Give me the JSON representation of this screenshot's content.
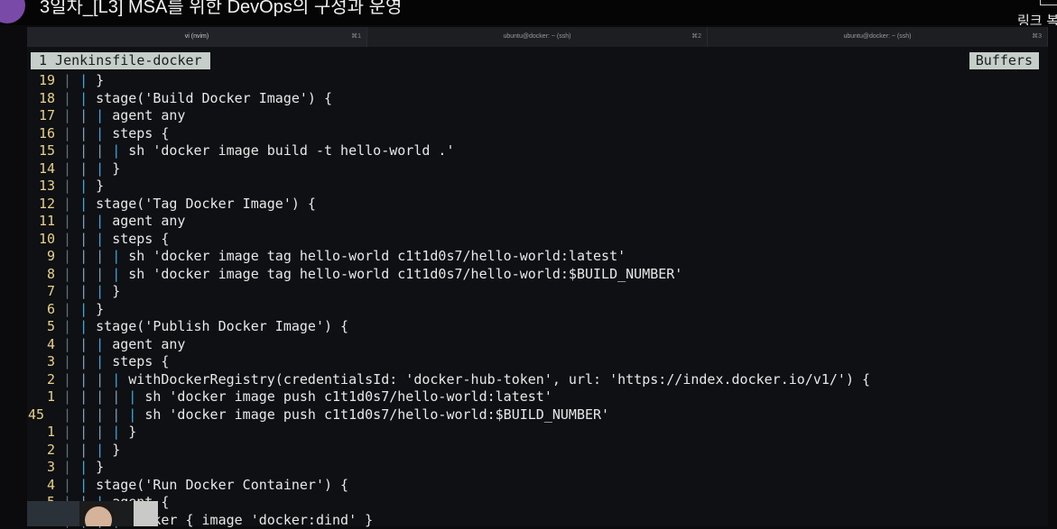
{
  "video": {
    "title": "3일차_[L3] MSA를 위한 DevOps의 구성과 운영",
    "corner_label": "링크 복"
  },
  "tabs": [
    {
      "label": "vi (nvim)",
      "key": "⌘1",
      "active": true
    },
    {
      "label": "ubuntu@docker: ~ (ssh)",
      "key": "⌘2",
      "active": false
    },
    {
      "label": "ubuntu@docker: ~ (ssh)",
      "key": "⌘3",
      "active": false
    }
  ],
  "bufferline": {
    "file": "1 Jenkinsfile-docker",
    "buffers_label": "Buffers"
  },
  "editor": {
    "current_line": "45",
    "lines": [
      {
        "n": "19",
        "indent": 2,
        "code": "}"
      },
      {
        "n": "18",
        "indent": 2,
        "code": "stage('Build Docker Image') {"
      },
      {
        "n": "17",
        "indent": 3,
        "code": "agent any"
      },
      {
        "n": "16",
        "indent": 3,
        "code": "steps {"
      },
      {
        "n": "15",
        "indent": 4,
        "code": "sh 'docker image build -t hello-world .'"
      },
      {
        "n": "14",
        "indent": 3,
        "code": "}"
      },
      {
        "n": "13",
        "indent": 2,
        "code": "}"
      },
      {
        "n": "12",
        "indent": 2,
        "code": "stage('Tag Docker Image') {"
      },
      {
        "n": "11",
        "indent": 3,
        "code": "agent any"
      },
      {
        "n": "10",
        "indent": 3,
        "code": "steps {"
      },
      {
        "n": "9",
        "indent": 4,
        "code": "sh 'docker image tag hello-world c1t1d0s7/hello-world:latest'"
      },
      {
        "n": "8",
        "indent": 4,
        "code": "sh 'docker image tag hello-world c1t1d0s7/hello-world:$BUILD_NUMBER'"
      },
      {
        "n": "7",
        "indent": 3,
        "code": "}"
      },
      {
        "n": "6",
        "indent": 2,
        "code": "}"
      },
      {
        "n": "5",
        "indent": 2,
        "code": "stage('Publish Docker Image') {"
      },
      {
        "n": "4",
        "indent": 3,
        "code": "agent any"
      },
      {
        "n": "3",
        "indent": 3,
        "code": "steps {"
      },
      {
        "n": "2",
        "indent": 4,
        "code": "withDockerRegistry(credentialsId: 'docker-hub-token', url: 'https://index.docker.io/v1/') {"
      },
      {
        "n": "1",
        "indent": 5,
        "code": "sh 'docker image push c1t1d0s7/hello-world:latest'"
      },
      {
        "n": "45",
        "indent": 5,
        "code": "sh 'docker image push c1t1d0s7/hello-world:$BUILD_NUMBER'",
        "current": true
      },
      {
        "n": "1",
        "indent": 4,
        "code": "}"
      },
      {
        "n": "2",
        "indent": 3,
        "code": "}"
      },
      {
        "n": "3",
        "indent": 2,
        "code": "}"
      },
      {
        "n": "4",
        "indent": 2,
        "code": "stage('Run Docker Container') {"
      },
      {
        "n": "5",
        "indent": 3,
        "code": "agent {"
      },
      {
        "n": "6",
        "indent": 4,
        "code": "docker { image 'docker:dind' }"
      }
    ]
  },
  "colors": {
    "line_number": "#e8d18a",
    "bufferline_bg": "#c5cec8",
    "indent_guide": "#3fa7df"
  }
}
